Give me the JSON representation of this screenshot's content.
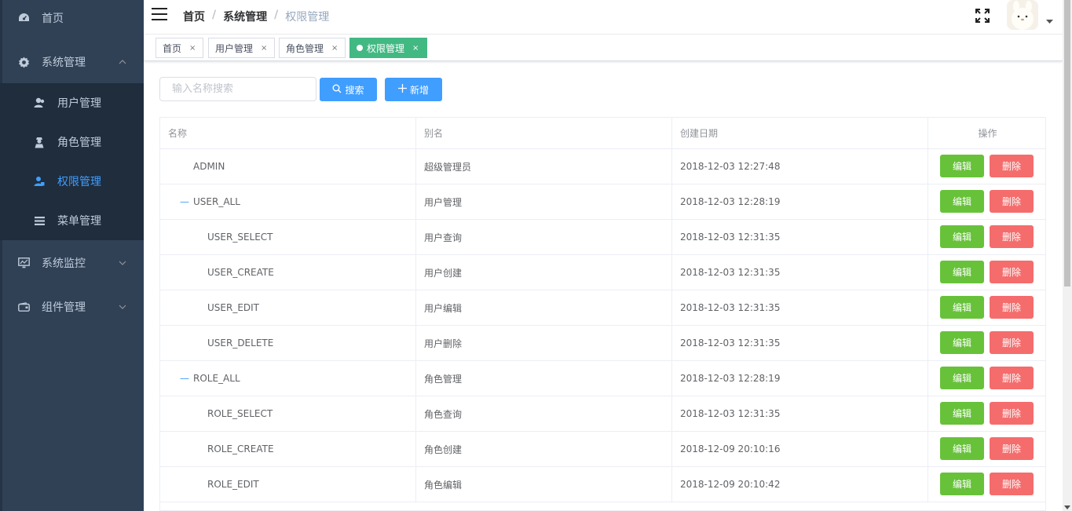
{
  "sidebar": {
    "items": [
      {
        "label": "首页",
        "icon": "dashboard-icon"
      },
      {
        "label": "系统管理",
        "icon": "gear-icon",
        "expanded": true
      },
      {
        "label": "系统监控",
        "icon": "monitor-icon"
      },
      {
        "label": "组件管理",
        "icon": "wallet-icon"
      }
    ],
    "sub_items": [
      {
        "label": "用户管理",
        "icon": "user-icon"
      },
      {
        "label": "角色管理",
        "icon": "role-icon"
      },
      {
        "label": "权限管理",
        "icon": "permission-icon",
        "active": true
      },
      {
        "label": "菜单管理",
        "icon": "menu-icon"
      }
    ]
  },
  "header": {
    "breadcrumb": [
      "首页",
      "系统管理",
      "权限管理"
    ],
    "separator": "/"
  },
  "tags": [
    {
      "label": "首页",
      "close": "×"
    },
    {
      "label": "用户管理",
      "close": "×"
    },
    {
      "label": "角色管理",
      "close": "×"
    },
    {
      "label": "权限管理",
      "close": "×",
      "active": true
    }
  ],
  "toolbar": {
    "search_placeholder": "输入名称搜索",
    "search_label": "搜索",
    "add_label": "新增"
  },
  "table": {
    "columns": [
      "名称",
      "别名",
      "创建日期",
      "操作"
    ],
    "edit_label": "编辑",
    "delete_label": "删除",
    "rows": [
      {
        "name": "ADMIN",
        "alias": "超级管理员",
        "date": "2018-12-03 12:27:48",
        "tree": "",
        "level": 0
      },
      {
        "name": "USER_ALL",
        "alias": "用户管理",
        "date": "2018-12-03 12:28:19",
        "tree": "—",
        "level": 0
      },
      {
        "name": "USER_SELECT",
        "alias": "用户查询",
        "date": "2018-12-03 12:31:35",
        "tree": "",
        "level": 1
      },
      {
        "name": "USER_CREATE",
        "alias": "用户创建",
        "date": "2018-12-03 12:31:35",
        "tree": "",
        "level": 1
      },
      {
        "name": "USER_EDIT",
        "alias": "用户编辑",
        "date": "2018-12-03 12:31:35",
        "tree": "",
        "level": 1
      },
      {
        "name": "USER_DELETE",
        "alias": "用户删除",
        "date": "2018-12-03 12:31:35",
        "tree": "",
        "level": 1
      },
      {
        "name": "ROLE_ALL",
        "alias": "角色管理",
        "date": "2018-12-03 12:28:19",
        "tree": "—",
        "level": 0
      },
      {
        "name": "ROLE_SELECT",
        "alias": "角色查询",
        "date": "2018-12-03 12:31:35",
        "tree": "",
        "level": 1
      },
      {
        "name": "ROLE_CREATE",
        "alias": "角色创建",
        "date": "2018-12-09 20:10:16",
        "tree": "",
        "level": 1
      },
      {
        "name": "ROLE_EDIT",
        "alias": "角色编辑",
        "date": "2018-12-09 20:10:42",
        "tree": "",
        "level": 1
      }
    ]
  },
  "colors": {
    "sidebar_bg": "#304156",
    "submenu_bg": "#1f2d3d",
    "active_text": "#409eff",
    "tag_active": "#42b983",
    "edit_button": "#67c23a",
    "delete_button": "#f56c6c",
    "primary_button": "#409eff"
  }
}
